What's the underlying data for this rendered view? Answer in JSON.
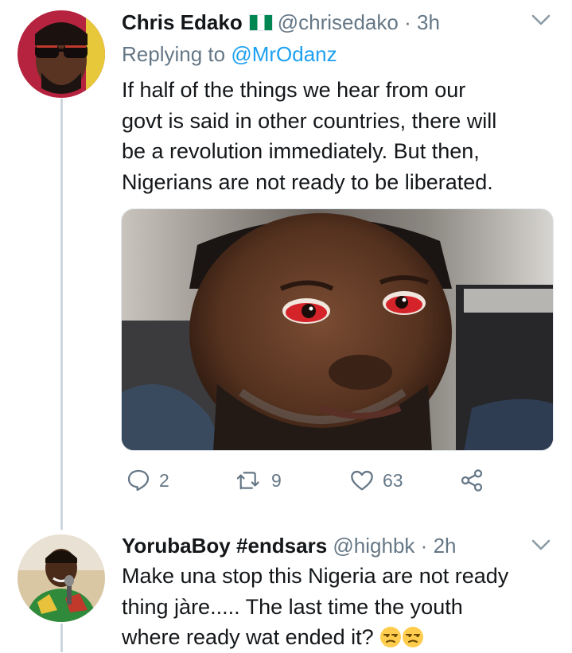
{
  "tweets": [
    {
      "display_name": "Chris Edako",
      "handle": "@chrisedako",
      "separator": "·",
      "time": "3h",
      "replying_prefix": "Replying to",
      "replying_to": "@MrOdanz",
      "text_lines": [
        "If half of the things we hear from our",
        "govt is said in other countries, there will",
        "be a revolution immediately. But then,",
        "Nigerians are not ready to be liberated."
      ],
      "actions": {
        "replies": "2",
        "retweets": "9",
        "likes": "63"
      }
    },
    {
      "display_name": "YorubaBoy #endsars",
      "handle": "@highbk",
      "separator": "·",
      "time": "2h",
      "text_lines": [
        "Make una stop this Nigeria are not ready",
        "thing jàre..... The last time the youth",
        "where ready wat ended it?"
      ],
      "emoji": [
        "unamused-face",
        "unamused-face"
      ]
    }
  ],
  "icons": [
    "chevron-down-icon",
    "reply-icon",
    "retweet-icon",
    "like-icon",
    "share-icon",
    "nigeria-flag-icon"
  ],
  "colors": {
    "link": "#1da1f2",
    "secondary_text": "#657786",
    "primary_text": "#14171a",
    "thread_line": "#ccd6dd"
  }
}
